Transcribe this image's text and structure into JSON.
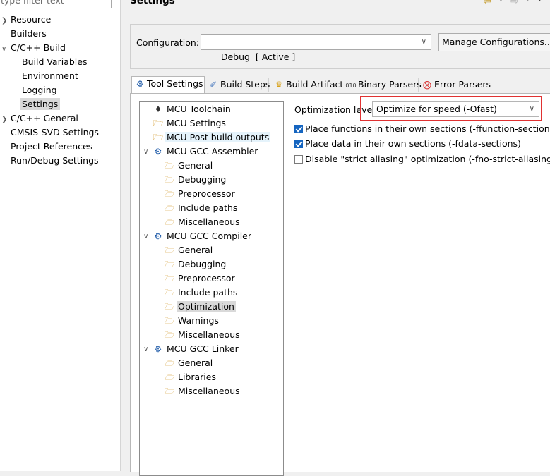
{
  "filter": {
    "placeholder": "type filter text"
  },
  "nav": {
    "items": [
      {
        "label": "Resource",
        "expandable": true
      },
      {
        "label": "Builders"
      },
      {
        "label": "C/C++ Build",
        "expandable": true,
        "expanded": true
      },
      {
        "label": "Build Variables"
      },
      {
        "label": "Environment"
      },
      {
        "label": "Logging"
      },
      {
        "label": "Settings",
        "selected": true
      },
      {
        "label": "C/C++ General",
        "expandable": true
      },
      {
        "label": "CMSIS-SVD Settings"
      },
      {
        "label": "Project References"
      },
      {
        "label": "Run/Debug Settings"
      }
    ]
  },
  "page": {
    "title": "Settings"
  },
  "config": {
    "label": "Configuration:",
    "value": "Debug  [ Active ]",
    "manage_label": "Manage Configurations..."
  },
  "tabs": [
    {
      "label": "Tool Settings",
      "icon": "tool-settings-icon",
      "active": true
    },
    {
      "label": "Build Steps",
      "icon": "build-steps-icon"
    },
    {
      "label": "Build Artifact",
      "icon": "build-artifact-icon"
    },
    {
      "label": "Binary Parsers",
      "icon": "binary-parsers-icon"
    },
    {
      "label": "Error Parsers",
      "icon": "error-parsers-icon"
    }
  ],
  "tool_tree": [
    {
      "label": "MCU Toolchain",
      "icon": "chip-icon"
    },
    {
      "label": "MCU Settings",
      "icon": "folder-icon"
    },
    {
      "label": "MCU Post build outputs",
      "icon": "folder-icon",
      "hover": true
    },
    {
      "label": "MCU GCC Assembler",
      "icon": "tool-icon",
      "expanded": true
    },
    {
      "label": "General",
      "icon": "folder-icon"
    },
    {
      "label": "Debugging",
      "icon": "folder-icon"
    },
    {
      "label": "Preprocessor",
      "icon": "folder-icon"
    },
    {
      "label": "Include paths",
      "icon": "folder-icon"
    },
    {
      "label": "Miscellaneous",
      "icon": "folder-icon"
    },
    {
      "label": "MCU GCC Compiler",
      "icon": "tool-icon",
      "expanded": true
    },
    {
      "label": "General",
      "icon": "folder-icon"
    },
    {
      "label": "Debugging",
      "icon": "folder-icon"
    },
    {
      "label": "Preprocessor",
      "icon": "folder-icon"
    },
    {
      "label": "Include paths",
      "icon": "folder-icon"
    },
    {
      "label": "Optimization",
      "icon": "folder-icon",
      "selected": true
    },
    {
      "label": "Warnings",
      "icon": "folder-icon"
    },
    {
      "label": "Miscellaneous",
      "icon": "folder-icon"
    },
    {
      "label": "MCU GCC Linker",
      "icon": "tool-icon",
      "expanded": true
    },
    {
      "label": "General",
      "icon": "folder-icon"
    },
    {
      "label": "Libraries",
      "icon": "folder-icon"
    },
    {
      "label": "Miscellaneous",
      "icon": "folder-icon"
    }
  ],
  "optimization": {
    "level_label": "Optimization level",
    "level_value": "Optimize for speed (-Ofast)",
    "options": [
      {
        "label": "Place functions in their own sections (-ffunction-sections)",
        "checked": true
      },
      {
        "label": "Place data in their own sections (-fdata-sections)",
        "checked": true
      },
      {
        "label": "Disable \"strict aliasing\" optimization (-fno-strict-aliasing)",
        "checked": false
      }
    ]
  },
  "colors": {
    "highlight": "#e03232",
    "checkbox_checked": "#1565c0",
    "selection": "#d9d9d9"
  }
}
